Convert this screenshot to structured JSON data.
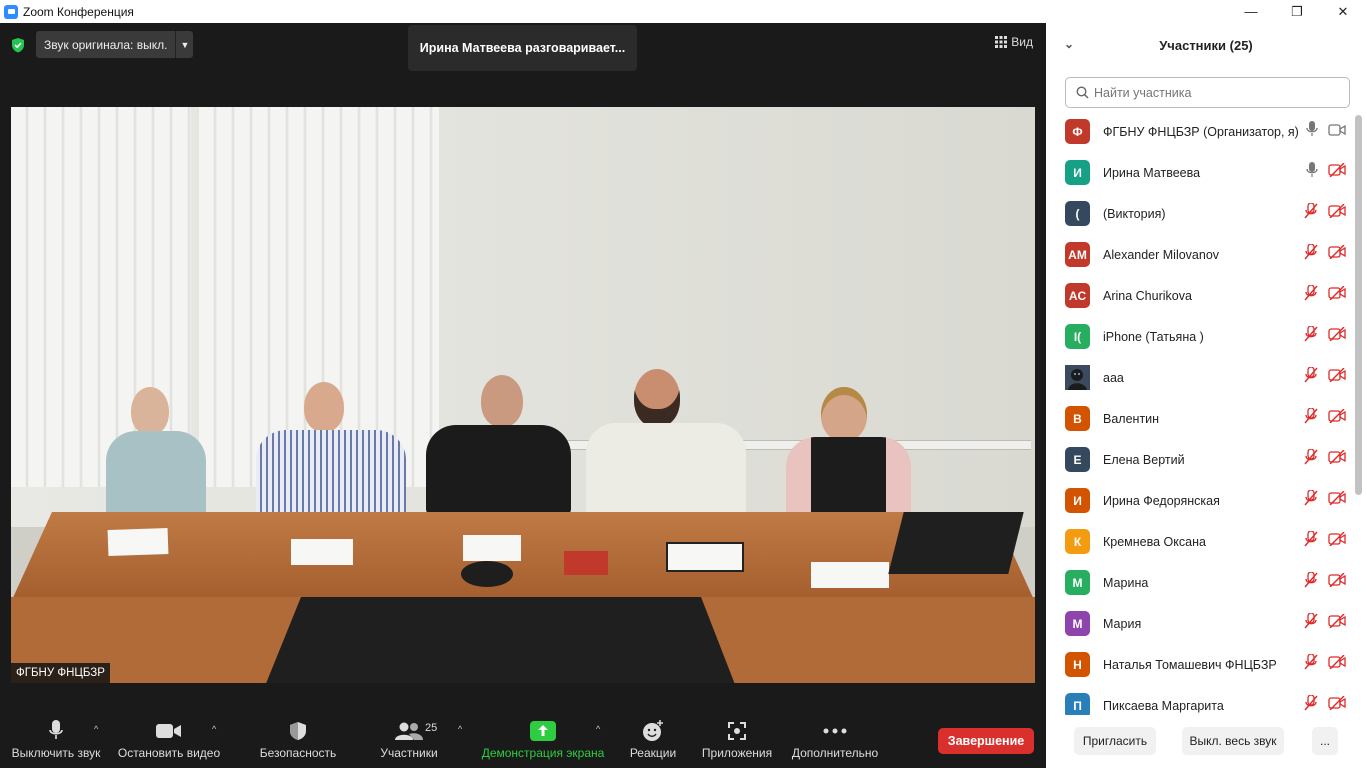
{
  "window": {
    "title": "Zoom Конференция",
    "controls": [
      "—",
      "❐",
      "✕"
    ]
  },
  "topbar": {
    "original_sound": "Звук оригинала: выкл.",
    "speaking_banner": "Ирина Матвеева разговаривает...",
    "view_label": "Вид"
  },
  "video": {
    "name_tag": "ФГБНУ ФНЦБЗР"
  },
  "toolbar": {
    "mute": "Выключить звук",
    "stop_video": "Остановить видео",
    "security": "Безопасность",
    "participants": "Участники",
    "participants_count": "25",
    "share": "Демонстрация экрана",
    "reactions": "Реакции",
    "apps": "Приложения",
    "more": "Дополнительно",
    "end": "Завершение"
  },
  "panel": {
    "title": "Участники (25)",
    "search_placeholder": "Найти участника",
    "participants": [
      {
        "initials": "Ф",
        "name": "ФГБНУ ФНЦБЗР (Организатор, я)",
        "color": "#c0392b",
        "mic": "on",
        "video": "on"
      },
      {
        "initials": "И",
        "name": "Ирина Матвеева",
        "color": "#16a085",
        "mic": "on",
        "video": "off"
      },
      {
        "initials": "(",
        "name": " (Виктория)",
        "color": "#34495e",
        "mic": "off",
        "video": "off"
      },
      {
        "initials": "AM",
        "name": "Alexander Milovanov",
        "color": "#c0392b",
        "mic": "off",
        "video": "off"
      },
      {
        "initials": "AC",
        "name": "Arina Churikova",
        "color": "#c0392b",
        "mic": "off",
        "video": "off"
      },
      {
        "initials": "I(",
        "name": "iPhone (Татьяна )",
        "color": "#27ae60",
        "mic": "off",
        "video": "off"
      },
      {
        "initials": "",
        "name": "aaa",
        "color": "#2c3e50",
        "mic": "off",
        "video": "off",
        "photo": true
      },
      {
        "initials": "В",
        "name": "Валентин",
        "color": "#d35400",
        "mic": "off",
        "video": "off"
      },
      {
        "initials": "Е",
        "name": "Елена Вертий",
        "color": "#34495e",
        "mic": "off",
        "video": "off"
      },
      {
        "initials": "И",
        "name": "Ирина Федорянская",
        "color": "#d35400",
        "mic": "off",
        "video": "off"
      },
      {
        "initials": "К",
        "name": "Кремнева Оксана",
        "color": "#f39c12",
        "mic": "off",
        "video": "off"
      },
      {
        "initials": "М",
        "name": "Марина",
        "color": "#27ae60",
        "mic": "off",
        "video": "off"
      },
      {
        "initials": "М",
        "name": "Мария",
        "color": "#8e44ad",
        "mic": "off",
        "video": "off"
      },
      {
        "initials": "Н",
        "name": "Наталья Томашевич ФНЦБЗР",
        "color": "#d35400",
        "mic": "off",
        "video": "off"
      },
      {
        "initials": "П",
        "name": "Пиксаева Маргарита",
        "color": "#2980b9",
        "mic": "off",
        "video": "off"
      }
    ],
    "invite": "Пригласить",
    "mute_all": "Выкл. весь звук",
    "more": "..."
  },
  "colors": {
    "meeting_bg": "#1a1a1a",
    "end_red": "#d9302e",
    "share_green": "#2ecc40",
    "muted_red": "#e02828"
  }
}
